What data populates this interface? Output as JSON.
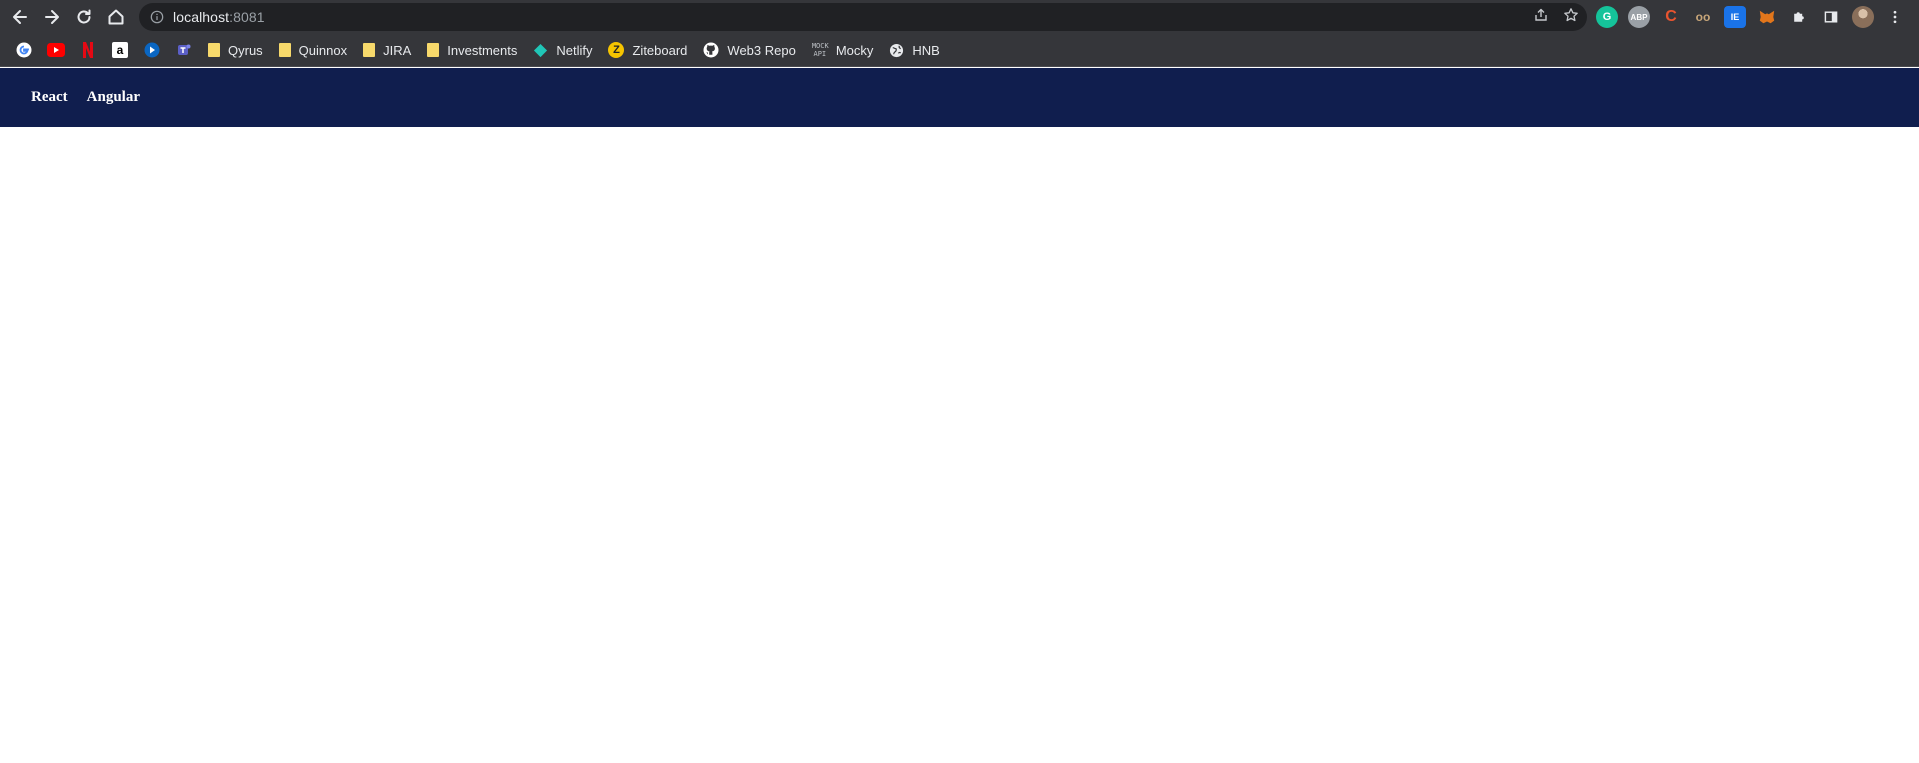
{
  "browser": {
    "url_host": "localhost",
    "url_port": ":8081",
    "nav_icons": [
      "back-icon",
      "forward-icon",
      "reload-icon",
      "home-icon"
    ],
    "omnibox_icons": [
      "info-icon",
      "share-icon",
      "star-icon"
    ],
    "extensions": [
      {
        "icon": "grammarly-icon",
        "glyph": "G",
        "color": "#15c39a"
      },
      {
        "icon": "adblock-icon",
        "glyph": "ABP",
        "color": "#9aa0a6"
      },
      {
        "icon": "c-extension-icon",
        "glyph": "C",
        "color": "#e8542f"
      },
      {
        "icon": "owl-extension-icon",
        "glyph": "oo",
        "color": "#b08a5a"
      },
      {
        "icon": "blue-square-extension-icon",
        "glyph": "IE",
        "color": "#1a73e8"
      },
      {
        "icon": "metamask-icon",
        "glyph": "M",
        "color": "#e2761b"
      },
      {
        "icon": "puzzle-icon",
        "glyph": "",
        "color": "#e8eaed"
      },
      {
        "icon": "side-panel-icon",
        "glyph": "",
        "color": "#e8eaed"
      },
      {
        "icon": "profile-avatar-icon",
        "glyph": "",
        "color": "#8a6f5a"
      },
      {
        "icon": "more-vert-icon",
        "glyph": "",
        "color": "#e8eaed"
      }
    ]
  },
  "bookmarks": {
    "icon_only": [
      {
        "icon": "google-icon"
      },
      {
        "icon": "youtube-icon"
      },
      {
        "icon": "netflix-icon"
      },
      {
        "icon": "amazon-icon"
      },
      {
        "icon": "play-icon"
      },
      {
        "icon": "teams-icon"
      }
    ],
    "items": [
      {
        "icon": "folder-icon",
        "label": "Qyrus"
      },
      {
        "icon": "folder-icon",
        "label": "Quinnox"
      },
      {
        "icon": "folder-icon",
        "label": "JIRA"
      },
      {
        "icon": "folder-icon",
        "label": "Investments"
      },
      {
        "icon": "netlify-icon",
        "label": "Netlify"
      },
      {
        "icon": "ziteboard-icon",
        "label": "Ziteboard"
      },
      {
        "icon": "github-icon",
        "label": "Web3 Repo"
      },
      {
        "icon": "mocky-icon",
        "label": "Mocky"
      },
      {
        "icon": "globe-icon",
        "label": "HNB"
      }
    ]
  },
  "app": {
    "nav_links": [
      "React",
      "Angular"
    ],
    "nav_color": "#101e4e"
  }
}
